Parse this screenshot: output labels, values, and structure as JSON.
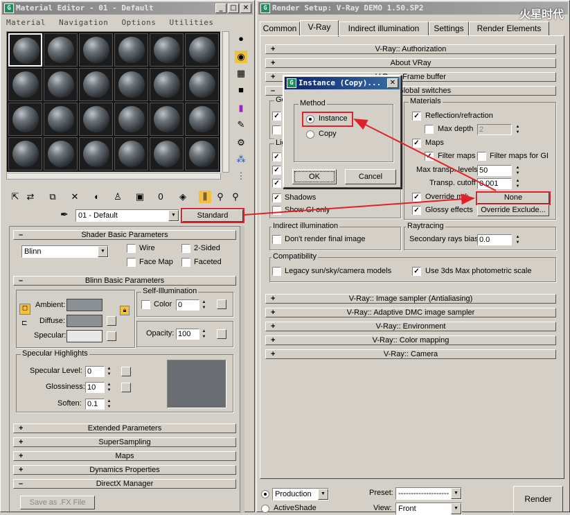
{
  "material_editor": {
    "title": "Material Editor - 01 - Default",
    "menu": [
      "Material",
      "Navigation",
      "Options",
      "Utilities"
    ],
    "material_name": "01 - Default",
    "material_type": "Standard",
    "shader": {
      "header": "Shader Basic Parameters",
      "shader_type": "Blinn",
      "wire": "Wire",
      "two_sided": "2-Sided",
      "face_map": "Face Map",
      "faceted": "Faceted"
    },
    "blinn": {
      "header": "Blinn Basic Parameters",
      "self_illum": "Self-Illumination",
      "color_label": "Color",
      "color_value": "0",
      "ambient": "Ambient:",
      "diffuse": "Diffuse:",
      "specular": "Specular:",
      "opacity_label": "Opacity:",
      "opacity_value": "100",
      "ambient_color": "#8a9094",
      "diffuse_color": "#8a9094",
      "specular_color": "#e8e8e8"
    },
    "highlights": {
      "header": "Specular Highlights",
      "spec_level_label": "Specular Level:",
      "spec_level": "0",
      "gloss_label": "Glossiness:",
      "gloss": "10",
      "soften_label": "Soften:",
      "soften": "0.1"
    },
    "rollouts": [
      "Extended Parameters",
      "SuperSampling",
      "Maps",
      "Dynamics Properties",
      "DirectX Manager"
    ],
    "save_fx": "Save as .FX File"
  },
  "render_setup": {
    "title": "Render Setup:  V-Ray DEMO 1.50.SP2",
    "tabs": [
      "Common",
      "V-Ray",
      "Indirect illumination",
      "Settings",
      "Render Elements"
    ],
    "rollouts_top": [
      "V-Ray:: Authorization",
      "About VRay",
      "V-Ray:: Frame buffer",
      "V-Ray:: Global switches"
    ],
    "geometry_label": "Ge",
    "lighting_label": "Lig",
    "shadows": "Shadows",
    "show_gi": "Show GI only",
    "materials": {
      "header": "Materials",
      "refl": "Reflection/refraction",
      "max_depth": "Max depth",
      "max_depth_val": "2",
      "maps": "Maps",
      "filter_maps": "Filter maps",
      "filter_maps_gi": "Filter maps for GI",
      "max_transp_label": "Max transp. levels",
      "max_transp": "50",
      "transp_cutoff_label": "Transp. cutoff",
      "transp_cutoff": "0.001",
      "override_mtl": "Override mtl:",
      "override_value": "None",
      "glossy": "Glossy effects",
      "override_exclude": "Override Exclude..."
    },
    "indirect": {
      "header": "Indirect illumination",
      "dont_render": "Don't render final image"
    },
    "raytracing": {
      "header": "Raytracing",
      "secondary_label": "Secondary rays bias",
      "secondary": "0.0"
    },
    "compat": {
      "header": "Compatibility",
      "legacy": "Legacy sun/sky/camera models",
      "use_3ds": "Use 3ds Max photometric scale"
    },
    "rollouts_bottom": [
      "V-Ray:: Image sampler (Antialiasing)",
      "V-Ray:: Adaptive DMC image sampler",
      "V-Ray:: Environment",
      "V-Ray:: Color mapping",
      "V-Ray:: Camera"
    ],
    "production": "Production",
    "activeshade": "ActiveShade",
    "preset_label": "Preset:",
    "preset": "--------------------",
    "view_label": "View:",
    "view": "Front",
    "render": "Render"
  },
  "dialog": {
    "title": "Instance (Copy)...",
    "method": "Method",
    "instance": "Instance",
    "copy": "Copy",
    "ok": "OK",
    "cancel": "Cancel"
  },
  "watermark": "火星时代",
  "colors": {
    "titlebar": "#0a246a",
    "highlight": "#e0202a",
    "face": "#d4d0c8"
  }
}
